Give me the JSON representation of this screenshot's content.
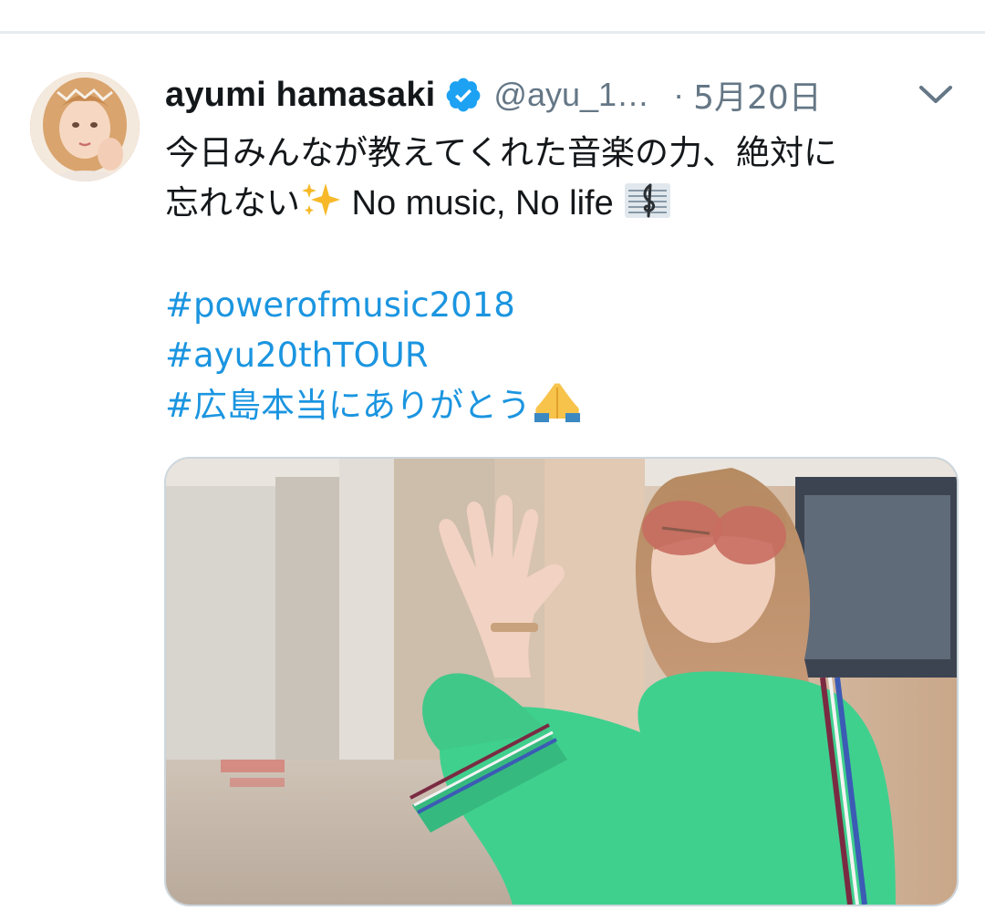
{
  "tweet": {
    "author": {
      "name": "ayumi hamasaki",
      "handle": "@ayu_1…",
      "verified": true
    },
    "separator": "·",
    "date": "5月20日",
    "text": {
      "line1": "今日みんなが教えてくれた音楽の力、絶対に",
      "line2_jp": "忘れない",
      "line2_en": " No music, No life ",
      "hashtags": [
        "#powerofmusic2018",
        "#ayu20thTOUR",
        "#広島本当にありがとう"
      ]
    },
    "icons": {
      "verified": "verified-badge-icon",
      "menu": "chevron-down-icon",
      "emoji_sparkles": "sparkles-emoji",
      "emoji_music": "musical-score-emoji",
      "emoji_pray": "folded-hands-emoji"
    },
    "colors": {
      "text": "#14171a",
      "secondary": "#657786",
      "link": "#1b95e0",
      "verified": "#1da1f2",
      "divider": "#e6ecf0"
    }
  }
}
